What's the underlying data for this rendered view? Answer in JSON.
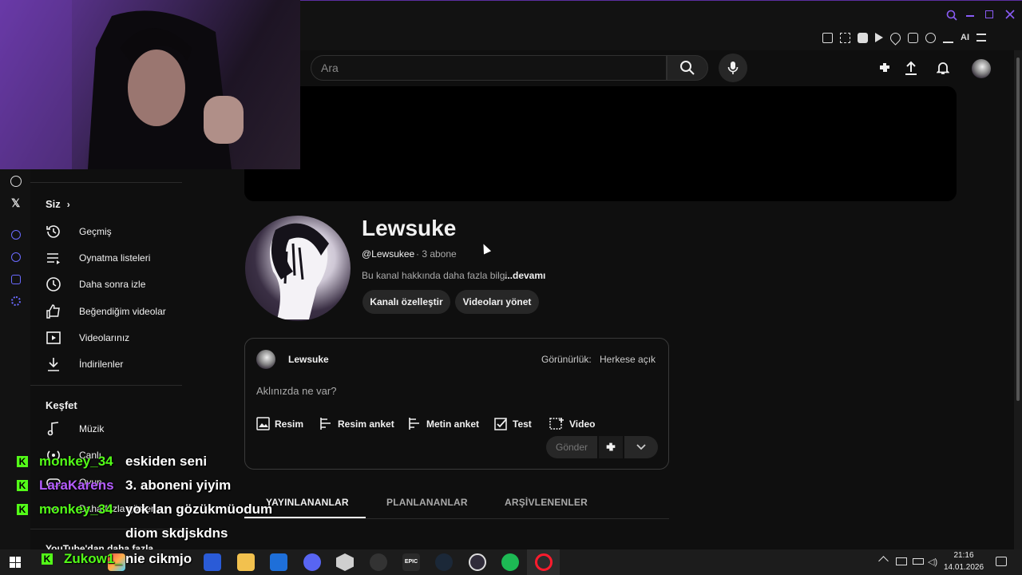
{
  "search": {
    "placeholder": "Ara"
  },
  "top_icons": [
    "search-icon",
    "minimize-icon",
    "restore-icon",
    "close-icon"
  ],
  "toolbar_ai_label": "AI",
  "channel": {
    "name": "Lewsuke",
    "handle": "@Lewsukee",
    "subscribers": "· 3 abone",
    "about": "Bu kanal hakkında daha fazla bilgi",
    "more": "...devamı",
    "customize_label": "Kanalı özelleştir",
    "manage_label": "Videoları yönet"
  },
  "composer": {
    "author": "Lewsuke",
    "visibility_label": "Görünürlük:",
    "visibility_value": "Herkese açık",
    "placeholder": "Aklınızda ne var?",
    "tools": [
      {
        "label": "Resim",
        "icon": "image-icon"
      },
      {
        "label": "Resim anket",
        "icon": "image-poll-icon"
      },
      {
        "label": "Metin anket",
        "icon": "text-poll-icon"
      },
      {
        "label": "Test",
        "icon": "quiz-icon"
      },
      {
        "label": "Video",
        "icon": "video-icon"
      }
    ],
    "send_label": "Gönder"
  },
  "tabs": [
    {
      "label": "YAYINLANANLAR",
      "active": true
    },
    {
      "label": "PLANLANANLAR",
      "active": false
    },
    {
      "label": "ARŞİVLENENLER",
      "active": false
    }
  ],
  "sidebar": {
    "you_label": "Siz",
    "items": [
      {
        "label": "Geçmiş",
        "icon": "history-icon"
      },
      {
        "label": "Oynatma listeleri",
        "icon": "playlist-icon"
      },
      {
        "label": "Daha sonra izle",
        "icon": "clock-icon"
      },
      {
        "label": "Beğendiğim videolar",
        "icon": "thumbs-up-icon"
      },
      {
        "label": "Videolarınız",
        "icon": "your-videos-icon"
      },
      {
        "label": "İndirilenler",
        "icon": "download-icon"
      }
    ],
    "explore_label": "Keşfet",
    "explore_items": [
      {
        "label": "Müzik",
        "icon": "music-icon"
      },
      {
        "label": "Canlı",
        "icon": "live-icon"
      },
      {
        "label": "Oyun",
        "icon": "gaming-icon"
      },
      {
        "label": "Daha fazla göster",
        "icon": "chevron-down-icon"
      }
    ],
    "more_from_label": "YouTube'dan daha fazla"
  },
  "chat": [
    {
      "user": "monkey_34",
      "message": "eskiden seni",
      "color": "#53fc18"
    },
    {
      "user": "LaraKarens",
      "message": "3. aboneni yiyim",
      "color": "#b45cff"
    },
    {
      "user": "monkey_34",
      "message": "yok lan gözükmüodum",
      "color": "#53fc18"
    },
    {
      "user": "",
      "message": "diom skdjskdns",
      "color": "#53fc18"
    },
    {
      "user": "Zukow1_",
      "message": "nie cikmjo",
      "color": "#53fc18"
    }
  ],
  "taskbar": {
    "time": "21:16",
    "date": "14.01.2026",
    "apps": [
      "windows-icon",
      "search-icon",
      "task-view-icon",
      "edge-icon",
      "browser-icon",
      "store-icon",
      "explorer-icon",
      "mail-icon",
      "discord-icon",
      "unity-icon",
      "github-icon",
      "epic-games-icon",
      "steam-icon",
      "obs-icon",
      "spotify-icon",
      "opera-icon"
    ]
  },
  "colors": {
    "accent": "#53fc18",
    "purple": "#b45cff",
    "background": "#0f0f0f"
  }
}
